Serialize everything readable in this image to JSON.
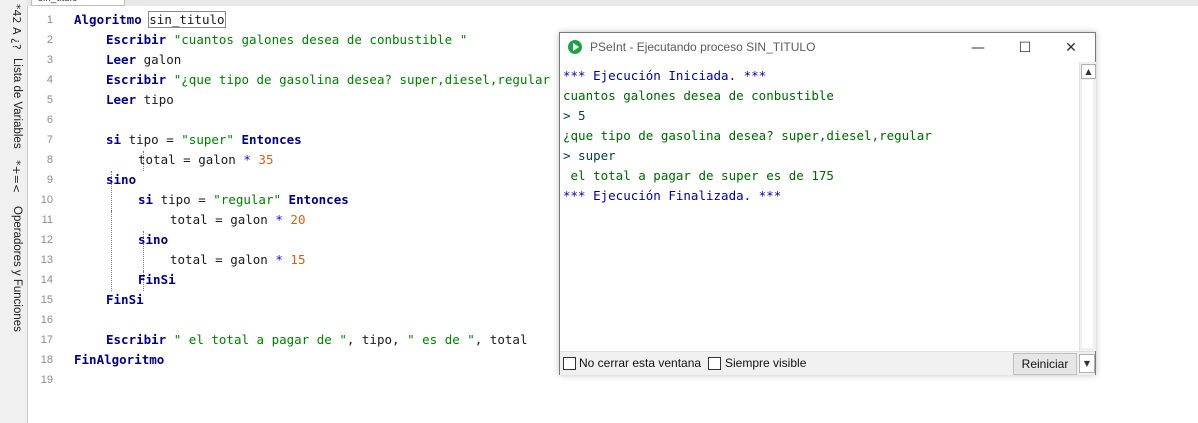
{
  "side_panel": {
    "top_symbols": "*42 A ¿?",
    "variables_label": "Lista de Variables",
    "operators_symbols": "*+=<",
    "operators_label": "Operadores y Funciones"
  },
  "tab": {
    "name": "sin_titulo",
    "close": "✕"
  },
  "line_numbers": [
    "1",
    "2",
    "3",
    "4",
    "5",
    "6",
    "7",
    "8",
    "9",
    "10",
    "11",
    "12",
    "13",
    "14",
    "15",
    "16",
    "17",
    "18",
    "19"
  ],
  "code": {
    "l1_kw": "Algoritmo",
    "l1_name": "sin_titulo",
    "l2_kw": "Escribir",
    "l2_str": "\"cuantos galones desea de conbustible \"",
    "l3_kw": "Leer",
    "l3_var": "galon",
    "l4_kw": "Escribir",
    "l4_str": "\"¿que tipo de gasolina desea? super,diesel,regular \"",
    "l5_kw": "Leer",
    "l5_var": "tipo",
    "l7_kw": "si",
    "l7_a": "tipo = ",
    "l7_str": "\"super\"",
    "l7_then": "Entonces",
    "l8_a": "total = galon ",
    "l8_op": "*",
    "l8_num": "35",
    "l9_kw": "sino",
    "l10_kw": "si",
    "l10_a": "tipo = ",
    "l10_str": "\"regular\"",
    "l10_then": "Entonces",
    "l11_a": "total = galon ",
    "l11_op": "*",
    "l11_num": "20",
    "l12_kw": "sino",
    "l13_a": "total = galon ",
    "l13_op": "*",
    "l13_num": "15",
    "l14_kw": "FinSi",
    "l15_kw": "FinSi",
    "l17_kw": "Escribir",
    "l17_s1": "\" el total a pagar de \"",
    "l17_m1": ", tipo, ",
    "l17_s2": "\" es de \"",
    "l17_m2": ", total",
    "l18_kw": "FinAlgoritmo"
  },
  "window": {
    "title": "PSeInt - Ejecutando proceso SIN_TITULO",
    "minimize": "—",
    "maximize": "☐",
    "close": "✕",
    "output": [
      "*** Ejecución Iniciada. ***",
      "cuantos galones desea de conbustible",
      "> 5",
      "¿que tipo de gasolina desea? super,diesel,regular",
      "> super",
      " el total a pagar de super es de 175",
      "*** Ejecución Finalizada. ***"
    ],
    "checkbox_no_cerrar": "No cerrar esta ventana",
    "checkbox_siempre_visible": "Siempre visible",
    "restart_button": "Reiniciar"
  }
}
